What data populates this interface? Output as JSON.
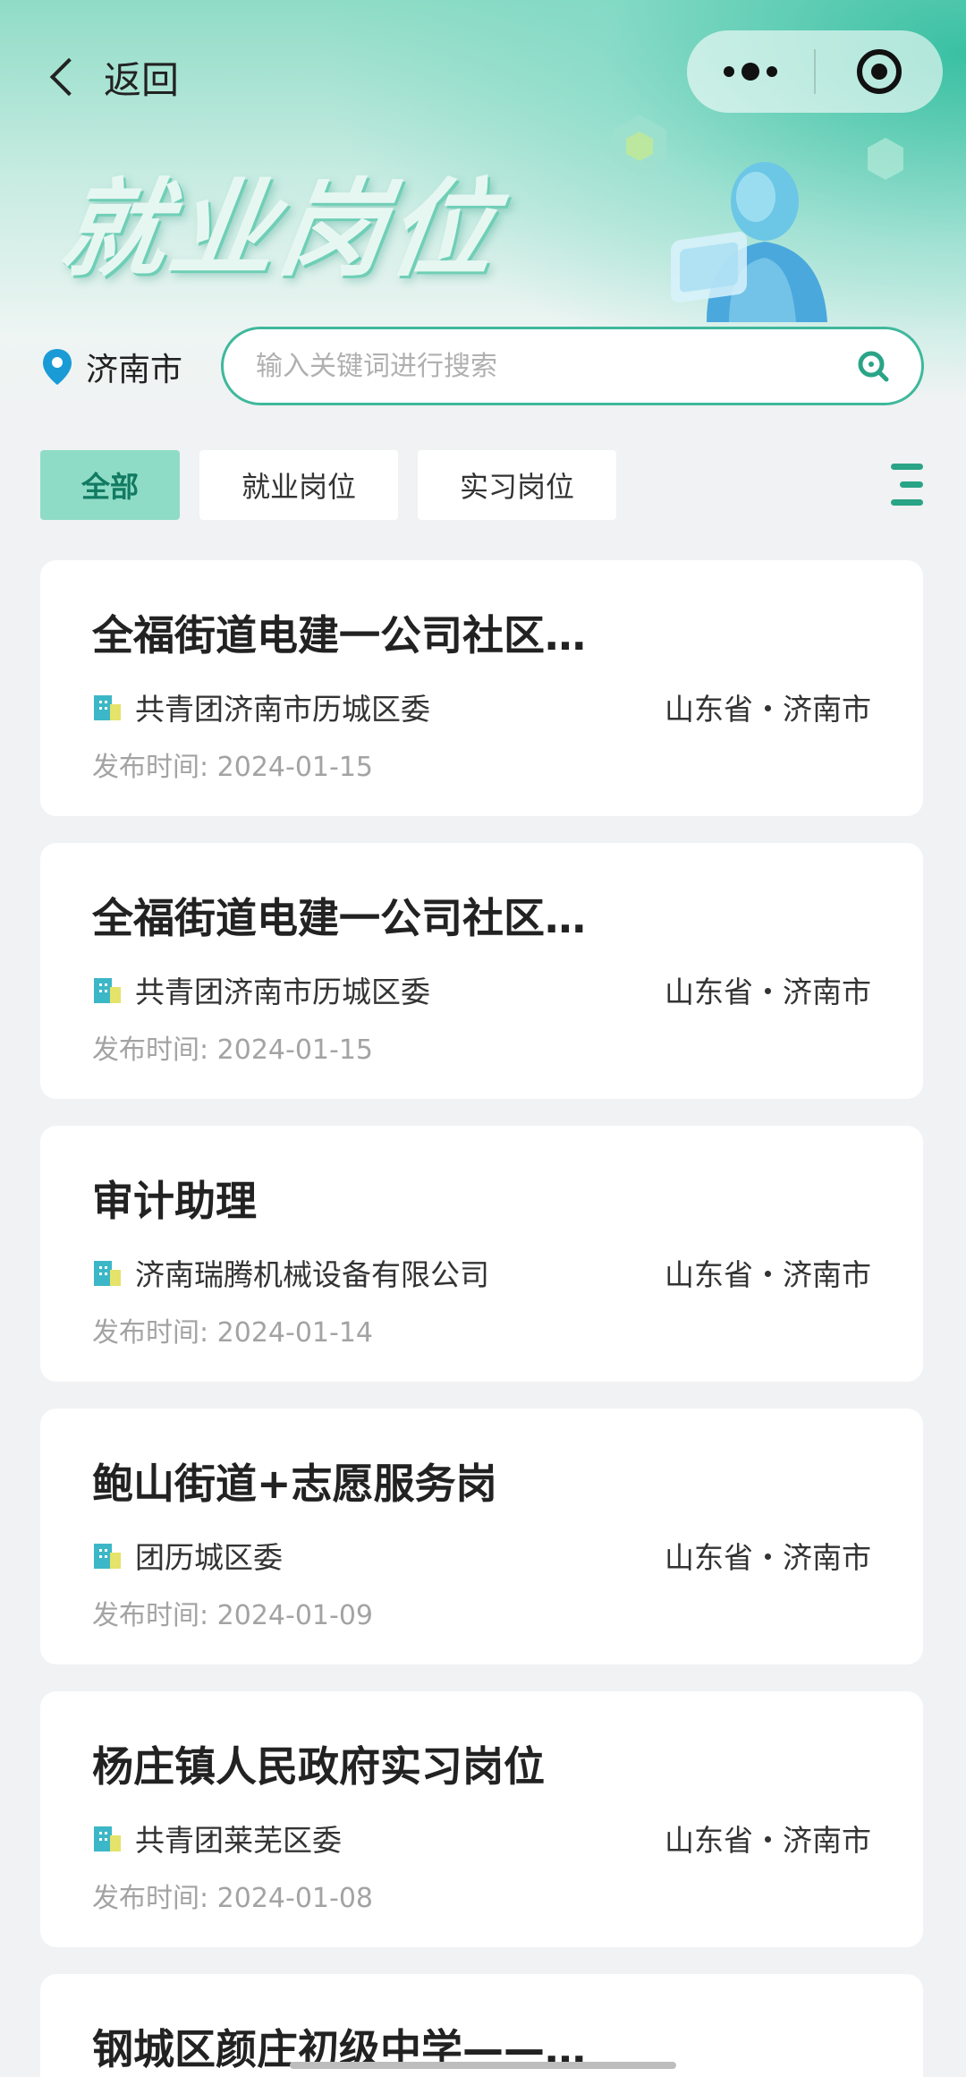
{
  "nav": {
    "back_label": "返回"
  },
  "banner": {
    "title": "就业岗位"
  },
  "location": {
    "city": "济南市"
  },
  "search": {
    "placeholder": "输入关键词进行搜索"
  },
  "tabs": [
    {
      "label": "全部",
      "active": true
    },
    {
      "label": "就业岗位",
      "active": false
    },
    {
      "label": "实习岗位",
      "active": false
    }
  ],
  "jobs": [
    {
      "title": "全福街道电建一公司社区…",
      "org": "共青团济南市历城区委",
      "location": "山东省・济南市",
      "date": "发布时间: 2024-01-15"
    },
    {
      "title": "全福街道电建一公司社区…",
      "org": "共青团济南市历城区委",
      "location": "山东省・济南市",
      "date": "发布时间: 2024-01-15"
    },
    {
      "title": "审计助理",
      "org": "济南瑞腾机械设备有限公司",
      "location": "山东省・济南市",
      "date": "发布时间: 2024-01-14"
    },
    {
      "title": "鲍山街道+志愿服务岗",
      "org": "团历城区委",
      "location": "山东省・济南市",
      "date": "发布时间: 2024-01-09"
    },
    {
      "title": "杨庄镇人民政府实习岗位",
      "org": "共青团莱芜区委",
      "location": "山东省・济南市",
      "date": "发布时间: 2024-01-08"
    },
    {
      "title": "钢城区颜庄初级中学——…"
    }
  ],
  "colors": {
    "accent": "#3fb89c",
    "tab_active_bg": "#8fdcc6",
    "tab_active_text": "#127a62"
  }
}
